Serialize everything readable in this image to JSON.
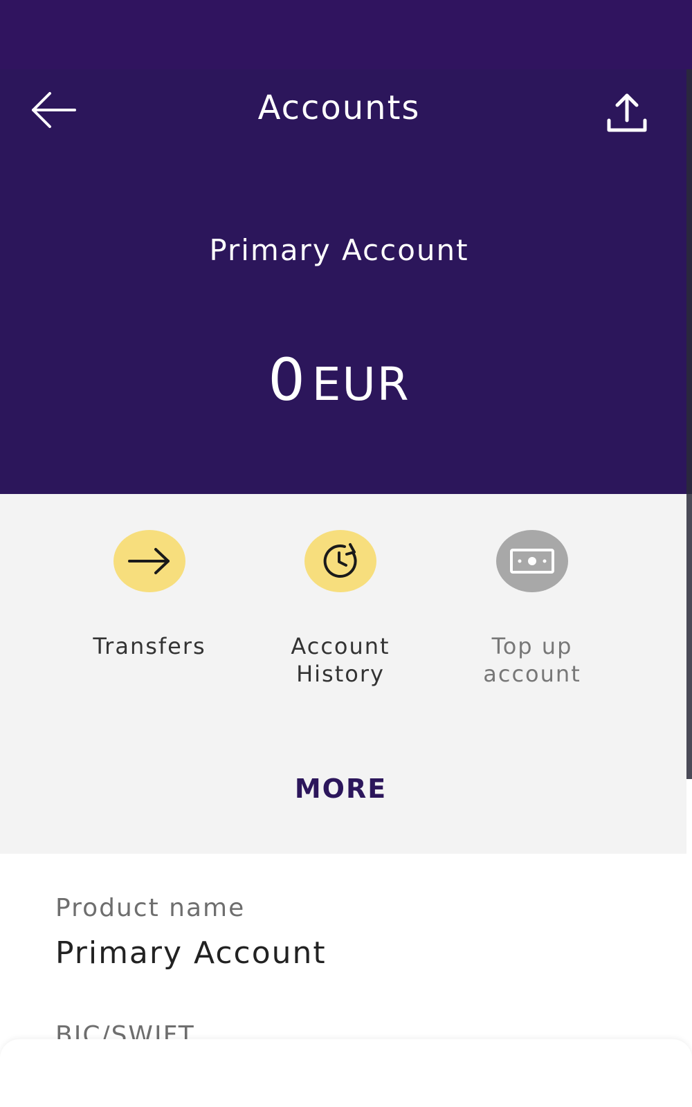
{
  "header": {
    "title": "Accounts",
    "back_icon": "arrow-left-icon",
    "share_icon": "upload-icon"
  },
  "account": {
    "name": "Primary Account",
    "balance": "0",
    "currency": "EUR"
  },
  "actions": [
    {
      "label": "Transfers",
      "icon": "arrow-right-icon",
      "color": "#f7de7d"
    },
    {
      "label": "Account\nHistory",
      "icon": "history-icon",
      "color": "#f7de7d"
    },
    {
      "label": "Top up\naccount",
      "icon": "banknote-icon",
      "color": "#a8a8a8"
    }
  ],
  "more_label": "MORE",
  "details": {
    "product_label": "Product name",
    "product_value": "Primary Account",
    "bic_label": "BIC/SWIFT"
  },
  "colors": {
    "header_bg": "#2c165b",
    "accent_yellow": "#f7de7d",
    "disabled_grey": "#a8a8a8"
  }
}
